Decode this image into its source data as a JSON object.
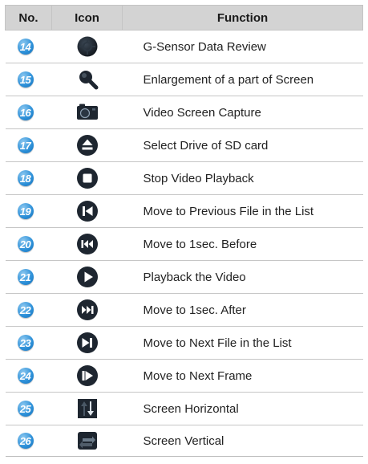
{
  "colors": {
    "header_bg": "#d3d3d3",
    "badge_blue": "#2b8fd8",
    "icon_dark": "#1e2630",
    "row_rule": "#c6c6c6"
  },
  "header": {
    "no": "No.",
    "icon": "Icon",
    "function": "Function"
  },
  "rows": [
    {
      "no": "14",
      "icon": "gsensor-icon",
      "function": "G-Sensor Data Review"
    },
    {
      "no": "15",
      "icon": "magnifier-icon",
      "function": "Enlargement of a part of Screen"
    },
    {
      "no": "16",
      "icon": "camera-icon",
      "function": "Video Screen Capture"
    },
    {
      "no": "17",
      "icon": "eject-icon",
      "function": "Select Drive of SD card"
    },
    {
      "no": "18",
      "icon": "stop-icon",
      "function": "Stop Video Playback"
    },
    {
      "no": "19",
      "icon": "previous-file-icon",
      "function": "Move to Previous File in the List"
    },
    {
      "no": "20",
      "icon": "rewind-icon",
      "function": "Move to 1sec. Before"
    },
    {
      "no": "21",
      "icon": "play-icon",
      "function": "Playback the Video"
    },
    {
      "no": "22",
      "icon": "fast-forward-icon",
      "function": "Move to 1sec. After"
    },
    {
      "no": "23",
      "icon": "next-file-icon",
      "function": "Move to Next File in the List"
    },
    {
      "no": "24",
      "icon": "next-frame-icon",
      "function": "Move to Next Frame"
    },
    {
      "no": "25",
      "icon": "flip-horizontal-icon",
      "function": "Screen Horizontal"
    },
    {
      "no": "26",
      "icon": "flip-vertical-icon",
      "function": "Screen Vertical"
    }
  ]
}
